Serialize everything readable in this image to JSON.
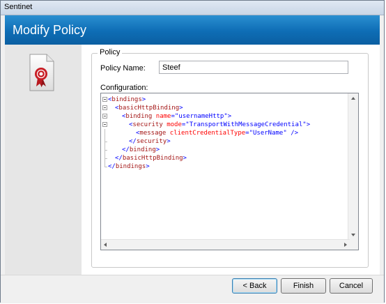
{
  "window": {
    "title": "Sentinet"
  },
  "banner": {
    "title": "Modify Policy"
  },
  "policy_group": {
    "legend": "Policy",
    "name_label": "Policy Name:",
    "name_value": "Steef",
    "config_label": "Configuration:"
  },
  "editor": {
    "lines": [
      {
        "indent": 0,
        "parts": [
          [
            "b",
            "<"
          ],
          [
            "t",
            "bindings"
          ],
          [
            "b",
            ">"
          ]
        ]
      },
      {
        "indent": 1,
        "parts": [
          [
            "b",
            "<"
          ],
          [
            "t",
            "basicHttpBinding"
          ],
          [
            "b",
            ">"
          ]
        ]
      },
      {
        "indent": 2,
        "parts": [
          [
            "b",
            "<"
          ],
          [
            "t",
            "binding"
          ],
          [
            "b",
            " "
          ],
          [
            "a",
            "name"
          ],
          [
            "b",
            "=\""
          ],
          [
            "v",
            "usernameHttp"
          ],
          [
            "b",
            "\">"
          ]
        ]
      },
      {
        "indent": 3,
        "parts": [
          [
            "b",
            "<"
          ],
          [
            "t",
            "security"
          ],
          [
            "b",
            " "
          ],
          [
            "a",
            "mode"
          ],
          [
            "b",
            "=\""
          ],
          [
            "v",
            "TransportWithMessageCredential"
          ],
          [
            "b",
            "\">"
          ]
        ]
      },
      {
        "indent": 4,
        "parts": [
          [
            "b",
            "<"
          ],
          [
            "t",
            "message"
          ],
          [
            "b",
            " "
          ],
          [
            "a",
            "clientCredentialType"
          ],
          [
            "b",
            "=\""
          ],
          [
            "v",
            "UserName"
          ],
          [
            "b",
            "\" />"
          ]
        ]
      },
      {
        "indent": 3,
        "parts": [
          [
            "b",
            "</"
          ],
          [
            "t",
            "security"
          ],
          [
            "b",
            ">"
          ]
        ]
      },
      {
        "indent": 2,
        "parts": [
          [
            "b",
            "</"
          ],
          [
            "t",
            "binding"
          ],
          [
            "b",
            ">"
          ]
        ]
      },
      {
        "indent": 1,
        "parts": [
          [
            "b",
            "</"
          ],
          [
            "t",
            "basicHttpBinding"
          ],
          [
            "b",
            ">"
          ]
        ]
      },
      {
        "indent": 0,
        "parts": [
          [
            "b",
            "</"
          ],
          [
            "t",
            "bindings"
          ],
          [
            "b",
            ">"
          ]
        ]
      }
    ]
  },
  "buttons": {
    "back": "< Back",
    "finish": "Finish",
    "cancel": "Cancel"
  },
  "icons": {
    "policy": "policy-document-icon"
  },
  "colors": {
    "banner": "#0e6db5",
    "xml_bracket": "#0000ff",
    "xml_tag": "#a31515",
    "xml_attr": "#ff0000",
    "xml_value": "#0000ff"
  }
}
